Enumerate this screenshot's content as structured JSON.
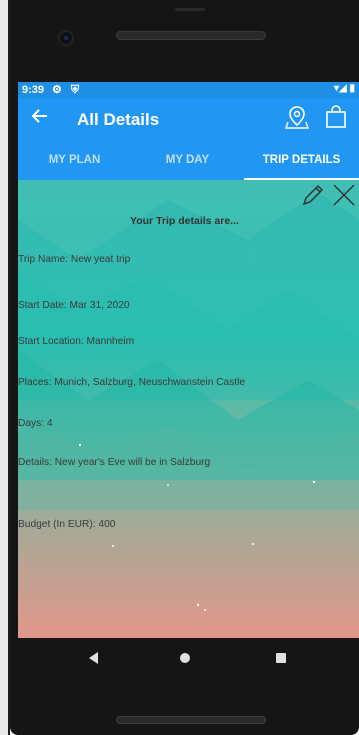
{
  "statusbar": {
    "time": "9:39",
    "icons_left": "⚙ ⛨",
    "icons_right": "▾◢ ▮"
  },
  "appbar": {
    "title": "All Details"
  },
  "tabs": [
    {
      "label": "MY PLAN"
    },
    {
      "label": "MY DAY"
    },
    {
      "label": "TRIP DETAILS",
      "active": true
    }
  ],
  "trip": {
    "heading": "Your Trip details are...",
    "trip_name": "Trip Name:  New yeat trip",
    "start_date": "Start Date:  Mar 31, 2020",
    "start_location": "Start Location:  Mannheim",
    "places": "Places:  Munich, Salzburg, Neuschwanstein Castle",
    "days": "Days:  4",
    "details": "Details:  New year's Eve will be in Salzburg",
    "budget": "Budget (In EUR):  400"
  },
  "colors": {
    "primary": "#2196f3",
    "statusbar": "#1f8fe6",
    "bg_top": "#2fb7b0",
    "bg_bottom": "#e2978a"
  }
}
